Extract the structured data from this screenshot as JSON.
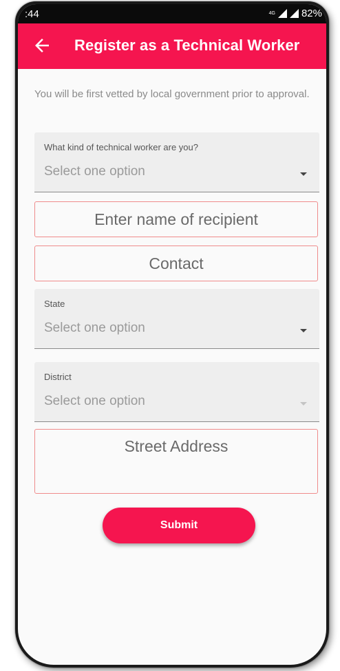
{
  "status_bar": {
    "time": ":44",
    "network": "4G",
    "battery": "82%"
  },
  "app_bar": {
    "back_icon": "arrow-left-icon",
    "title": "Register as a Technical Worker",
    "color": "#f5154f"
  },
  "intro_text": "You will be first vetted by local government prior to approval.",
  "form": {
    "worker_type": {
      "label": "What kind of technical worker are you?",
      "value": "Select one option"
    },
    "recipient_name": {
      "placeholder": "Enter name of recipient"
    },
    "contact": {
      "placeholder": "Contact"
    },
    "state": {
      "label": "State",
      "value": "Select one option"
    },
    "district": {
      "label": "District",
      "value": "Select one option"
    },
    "street_address": {
      "placeholder": "Street Address"
    },
    "submit_label": "Submit"
  }
}
